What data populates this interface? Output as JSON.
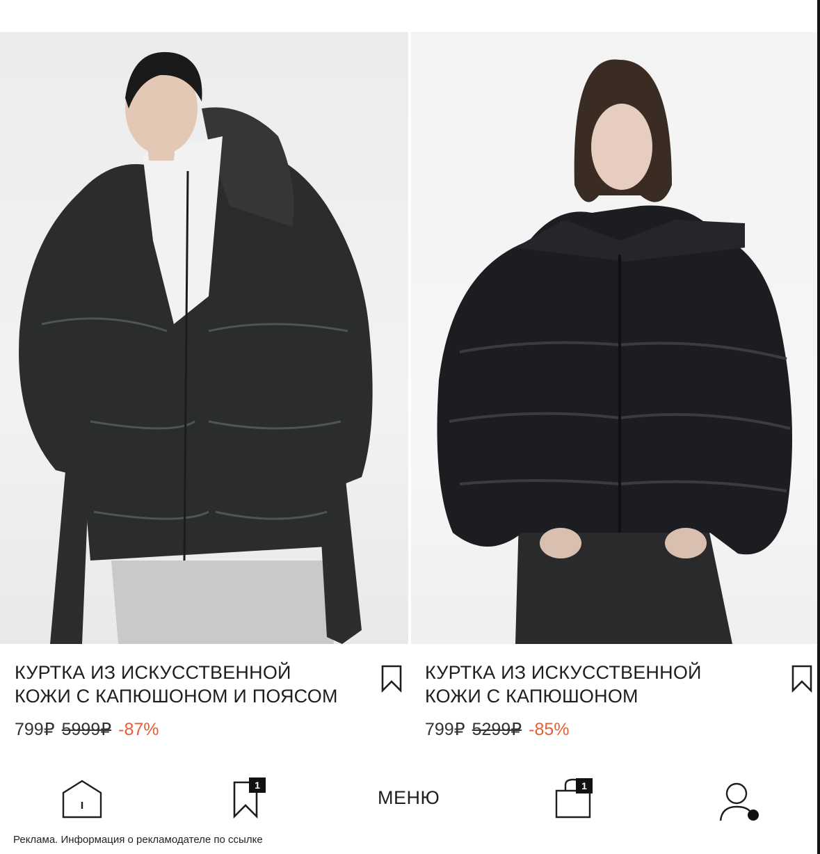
{
  "products": [
    {
      "title_line1": "КУРТКА ИЗ ИСКУССТВЕННОЙ",
      "title_line2": "КОЖИ С КАПЮШОНОМ И ПОЯСОМ",
      "price": "799₽",
      "old_price": "5999₽",
      "discount": "-87%",
      "image_icon": "model-photo-long-hooded-belted-jacket"
    },
    {
      "title_line1": "КУРТКА ИЗ ИСКУССТВЕННОЙ",
      "title_line2": "КОЖИ С КАПЮШОНОМ",
      "price": "799₽",
      "old_price": "5299₽",
      "discount": "-85%",
      "image_icon": "model-photo-cropped-puffer-jacket"
    }
  ],
  "bottom_nav": {
    "home_icon": "home-icon",
    "favorites_icon": "bookmark-icon",
    "favorites_count": "1",
    "menu_label": "МЕНЮ",
    "cart_icon": "shopping-bag-icon",
    "cart_count": "1",
    "profile_icon": "user-icon"
  },
  "ad_notice": "Реклама. Информация о рекламодателе по ссылке",
  "colors": {
    "discount": "#e0613a",
    "text": "#1e1e1e",
    "badge": "#111111"
  }
}
